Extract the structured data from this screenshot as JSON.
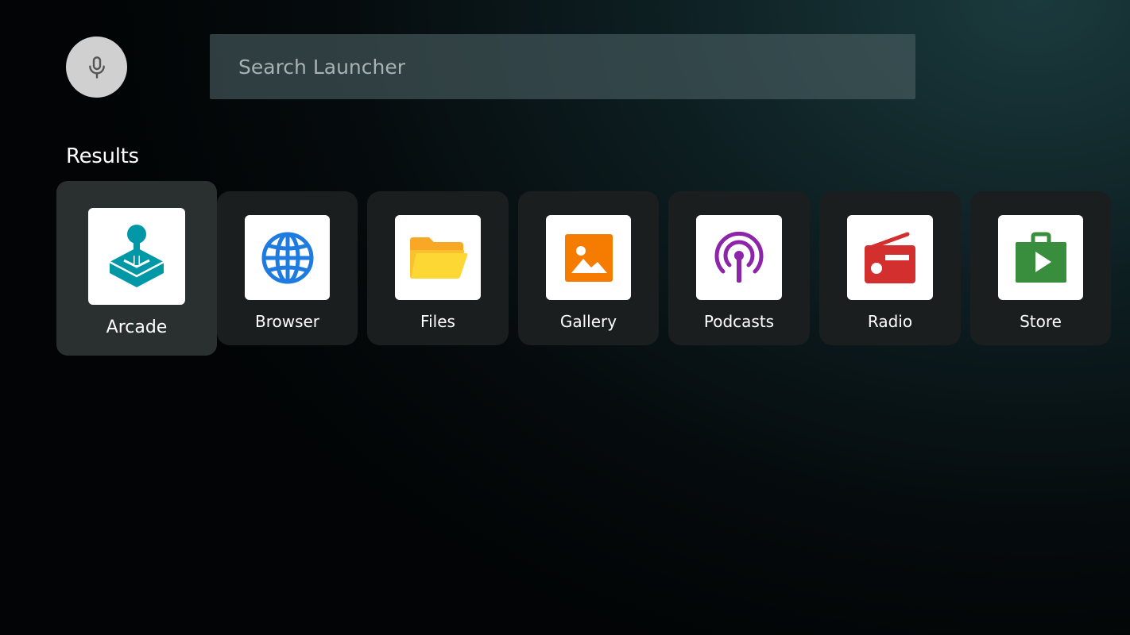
{
  "search": {
    "placeholder": "Search Launcher",
    "value": ""
  },
  "section": {
    "title": "Results"
  },
  "apps": [
    {
      "label": "Arcade",
      "icon": "joystick-icon",
      "color": "#0097a7",
      "focused": true
    },
    {
      "label": "Browser",
      "icon": "globe-icon",
      "color": "#1e7be0",
      "focused": false
    },
    {
      "label": "Files",
      "icon": "folder-icon",
      "color": "#fbc02d",
      "focused": false
    },
    {
      "label": "Gallery",
      "icon": "image-icon",
      "color": "#f57c00",
      "focused": false
    },
    {
      "label": "Podcasts",
      "icon": "podcast-icon",
      "color": "#8e24aa",
      "focused": false
    },
    {
      "label": "Radio",
      "icon": "radio-icon",
      "color": "#d32f2f",
      "focused": false
    },
    {
      "label": "Store",
      "icon": "store-bag-icon",
      "color": "#388e3c",
      "focused": false
    }
  ],
  "colors": {
    "mic_background": "#d0d0d0",
    "mic_icon": "#555555",
    "tile_background": "#1a1e1f",
    "tile_focused_background": "#2a2f30"
  }
}
